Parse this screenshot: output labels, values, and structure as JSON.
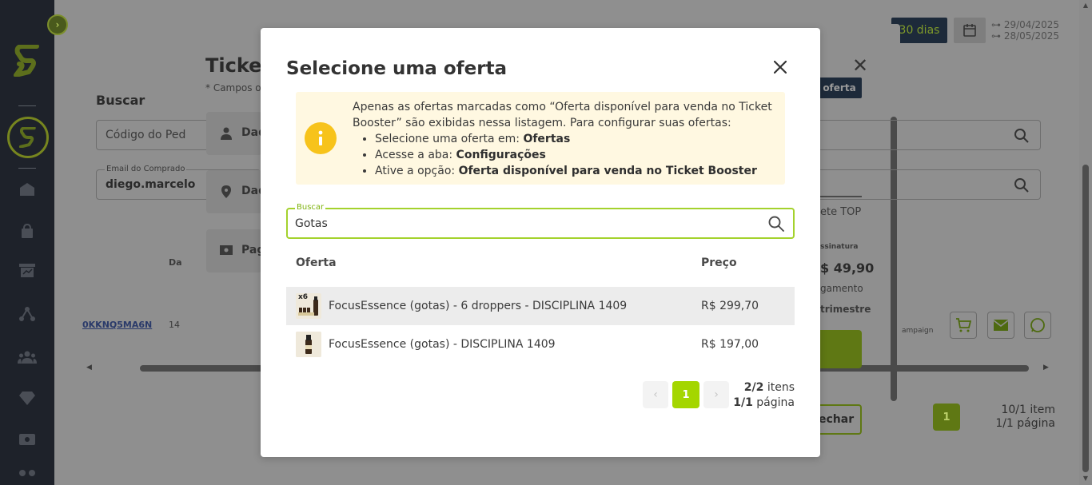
{
  "background": {
    "period_button": "30 dias",
    "date_start": "29/04/2025",
    "date_end": "28/05/2025",
    "parent_modal": {
      "title": "Ticket",
      "subtitle": "* Campos o",
      "search_heading": "Buscar",
      "order_code_placeholder": "Código do Ped",
      "buyer_email_label": "Email do Comprado",
      "buyer_email_value": "diego.marcelo",
      "card_1": "Dad",
      "card_2": "Dad",
      "card_3": "Pag",
      "table_col": "Da",
      "row_code": "0KKNQ5MA6N",
      "row_val": "14",
      "oferta_tag": "oferta",
      "pacote": "ete TOP",
      "assinatura": "ssinatura",
      "price": "$ 49,90",
      "pagamento": "gamento",
      "periodo": "trimestre",
      "campaign": "ampaign",
      "fechar": "echar",
      "page": "1",
      "items_count": "10/1 item",
      "pages_count": "1/1 página"
    }
  },
  "modal": {
    "title": "Selecione uma oferta",
    "alert": {
      "intro": "Apenas as ofertas marcadas como “Oferta disponível para venda no Ticket Booster” são exibidas nessa listagem. Para configurar suas ofertas:",
      "steps": [
        {
          "prefix": "Selecione uma oferta em: ",
          "bold": "Ofertas"
        },
        {
          "prefix": "Acesse a aba: ",
          "bold": "Configurações"
        },
        {
          "prefix": "Ative a opção: ",
          "bold": "Oferta disponível para venda no Ticket Booster"
        }
      ]
    },
    "search": {
      "label": "Buscar",
      "value": "Gotas"
    },
    "table": {
      "headers": {
        "offer": "Oferta",
        "price": "Preço"
      },
      "rows": [
        {
          "name": "FocusEssence (gotas) - 6 droppers - DISCIPLINA 1409",
          "price": "R$ 299,70",
          "thumb_badge": "x6"
        },
        {
          "name": "FocusEssence (gotas) - DISCIPLINA 1409",
          "price": "R$ 197,00",
          "thumb_badge": ""
        }
      ]
    },
    "pagination": {
      "current_page": "1",
      "items_bold": "2/2",
      "items_suffix": " itens",
      "pages_bold": "1/1",
      "pages_suffix": " página"
    }
  },
  "colors": {
    "accent_green": "#a4d600",
    "search_border": "#a4d22d",
    "alert_bg": "#fff8e1",
    "alert_icon": "#f7c31b",
    "sidebar": "#1e222a"
  }
}
